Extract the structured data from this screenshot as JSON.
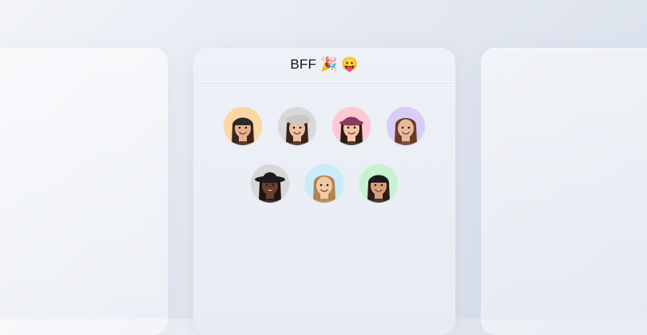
{
  "group": {
    "title": "BFF 🎉 😛"
  },
  "members": [
    {
      "name": "member-1",
      "bg": "#fdd7a3",
      "skin": "#e7b18f",
      "hair": "#3a261d",
      "hat": "#2a2a2a",
      "hatStyle": "beanie"
    },
    {
      "name": "member-2",
      "bg": "#d9d9d9",
      "skin": "#ecc1a3",
      "hair": "#3b241a",
      "hat": "#c9c9c9",
      "hatStyle": "beret"
    },
    {
      "name": "member-3",
      "bg": "#ffc9d2",
      "skin": "#f1c7a8",
      "hair": "#2f1c17",
      "hat": "#8a3b5c",
      "hatStyle": "bucket"
    },
    {
      "name": "member-4",
      "bg": "#d9cdf8",
      "skin": "#e7b99c",
      "hair": "#6b3a2b",
      "hat": "",
      "hatStyle": "none"
    },
    {
      "name": "member-5",
      "bg": "#d8d8d8",
      "skin": "#6a3f2c",
      "hair": "#1e1410",
      "hat": "#1c1c1c",
      "hatStyle": "cowboy"
    },
    {
      "name": "member-6",
      "bg": "#c9ebfa",
      "skin": "#f2c9a8",
      "hair": "#b2824f",
      "hat": "",
      "hatStyle": "none"
    },
    {
      "name": "member-7",
      "bg": "#c8f2cf",
      "skin": "#d6a07d",
      "hair": "#2b1d17",
      "hat": "#1a1a1a",
      "hatStyle": "beanie"
    }
  ]
}
